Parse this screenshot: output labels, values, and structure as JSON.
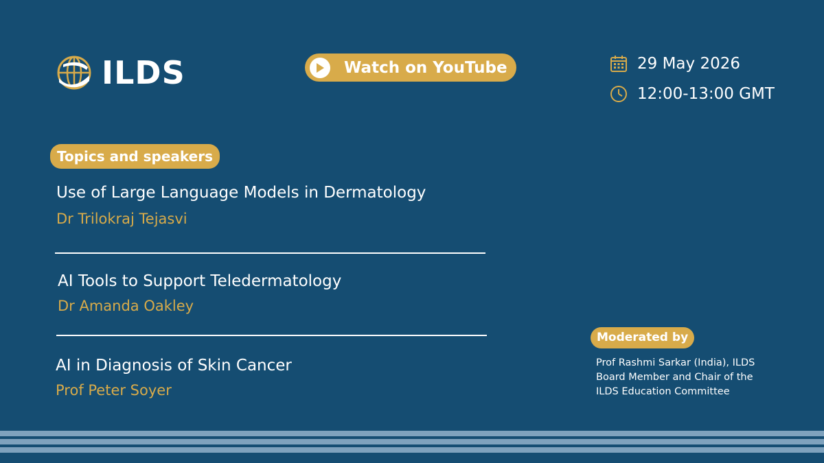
{
  "logo": {
    "text": "ILDS",
    "icon": "globe-icon"
  },
  "watch_button": {
    "label": "Watch on YouTube",
    "icon": "play-icon"
  },
  "event": {
    "date": "29 May 2026",
    "date_icon": "calendar-icon",
    "time": "12:00-13:00 GMT",
    "time_icon": "clock-icon"
  },
  "topics": {
    "heading": "Topics and speakers",
    "items": [
      {
        "title": "Use of Large Language Models in Dermatology",
        "speaker": "Dr Trilokraj Tejasvi"
      },
      {
        "title": "AI Tools to Support Teledermatology",
        "speaker": "Dr Amanda Oakley"
      },
      {
        "title": "AI in Diagnosis of Skin Cancer",
        "speaker": "Prof Peter Soyer"
      }
    ]
  },
  "moderator": {
    "heading": "Moderated by",
    "lines": [
      "Prof Rashmi Sarkar (India), ILDS",
      "Board Member and Chair of the",
      "ILDS Education Committee"
    ]
  },
  "colors": {
    "background": "#154d72",
    "accent": "#d8ab4a",
    "stripes": "#7fa2bd"
  }
}
